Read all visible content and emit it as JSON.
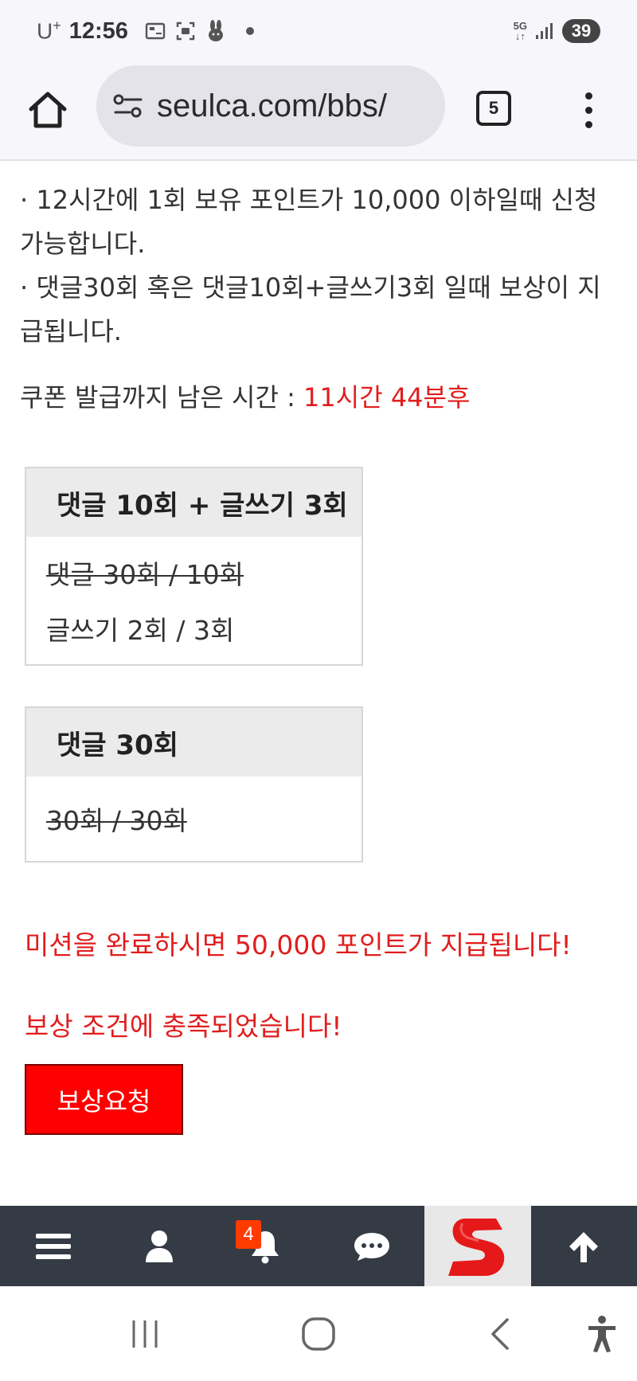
{
  "status_bar": {
    "carrier": "U",
    "carrier_sup": "+",
    "time": "12:56",
    "network": "5G",
    "battery": "39"
  },
  "browser": {
    "url": "seulca.com/bbs/",
    "tab_count": "5"
  },
  "content": {
    "rules": [
      "· 12시간에 1회 보유 포인트가 10,000 이하일때 신청가능합니다.",
      "· 댓글30회 혹은 댓글10회+글쓰기3회 일때 보상이 지급됩니다."
    ],
    "coupon_label": "쿠폰 발급까지 남은 시간 : ",
    "coupon_time": "11시간 44분후",
    "missions": [
      {
        "title": "댓글 10회 + 글쓰기 3회",
        "rows": [
          "댓글 30회 / 10회",
          "글쓰기 2회 / 3회"
        ]
      },
      {
        "title": "댓글 30회",
        "rows": [
          "30회 / 30회"
        ]
      }
    ],
    "reward_message": "미션을 완료하시면 50,000 포인트가 지급됩니다!",
    "condition_message": "보상 조건에 충족되었습니다!",
    "reward_button": "보상요청"
  },
  "site_nav": {
    "notification_count": "4",
    "logo_letter": "S"
  },
  "colors": {
    "accent_red": "#e11d1d",
    "button_red": "#ff0000",
    "nav_bg": "#353b45",
    "badge": "#ff3b00"
  },
  "icons": [
    "home-icon",
    "site-settings-icon",
    "tabs-icon",
    "more-vert-icon",
    "menu-icon",
    "user-icon",
    "bell-icon",
    "chat-icon",
    "site-logo",
    "arrow-up-icon",
    "recent-apps-icon",
    "home-circle-icon",
    "back-icon",
    "accessibility-icon"
  ]
}
